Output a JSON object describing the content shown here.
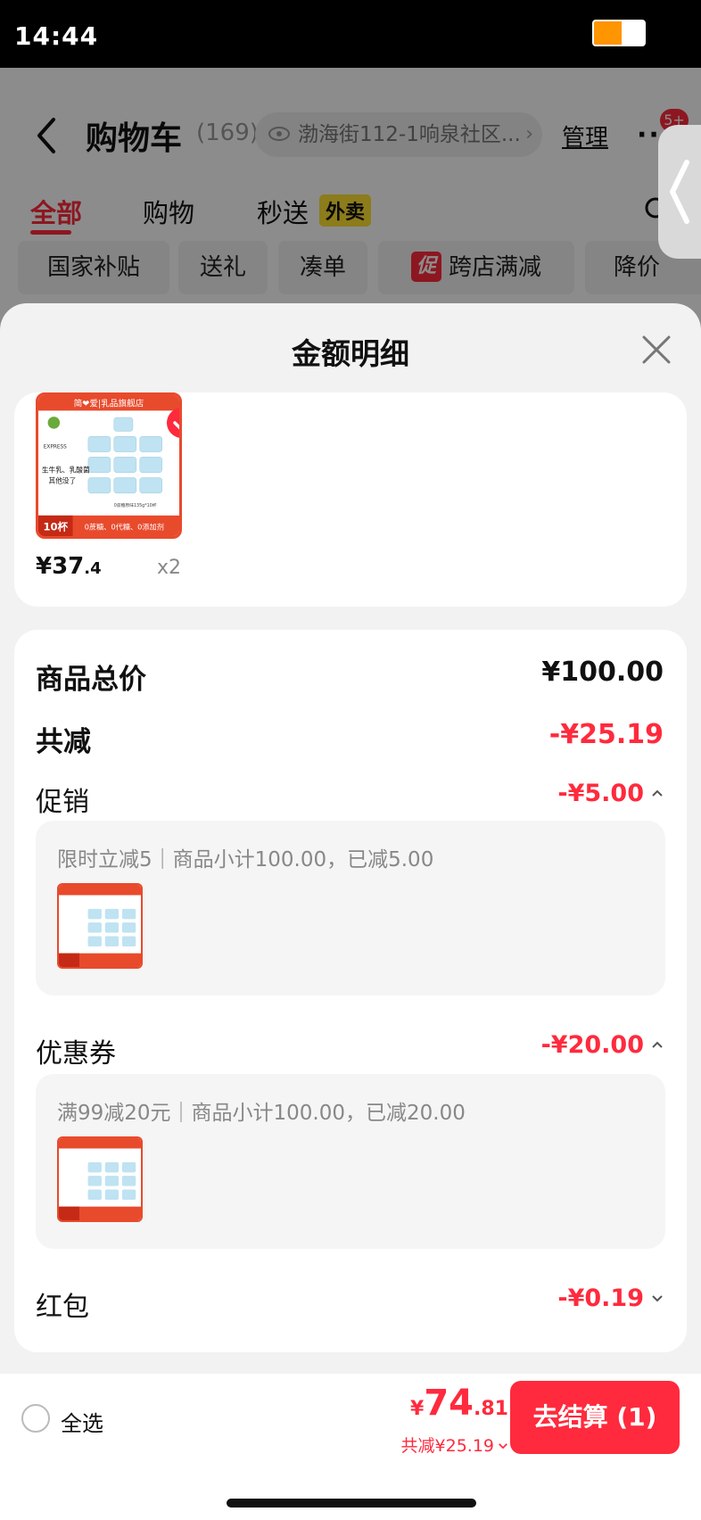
{
  "status_bar": {
    "time": "14:44",
    "battery_level": 0.55
  },
  "header": {
    "title": "购物车",
    "count": "(169)",
    "address": "渤海街112-1响泉社区...",
    "address_chevron": "›",
    "manage": "管理",
    "more": "··",
    "badge": "5+"
  },
  "tabs": [
    {
      "label": "全部"
    },
    {
      "label": "购物"
    },
    {
      "label": "秒送"
    }
  ],
  "waimai_tag": "外卖",
  "filters": [
    {
      "label": "国家补贴"
    },
    {
      "label": "送礼"
    },
    {
      "label": "凑单"
    },
    {
      "label": "跨店满减",
      "tag": "促"
    },
    {
      "label": "降价"
    }
  ],
  "sheet": {
    "title": "金额明细",
    "product": {
      "price_main": "¥37",
      "price_decimal": ".4",
      "quantity": "x2",
      "image_label_store": "简❤爱|乳品旗舰店",
      "image_label_line1": "生牛乳、乳酸菌",
      "image_label_line2": "其他没了",
      "image_label_cups": "10杯",
      "image_label_bottom": "0蔗糖、0代糖、0添加剂",
      "image_label_spec": "0蔗糖原味135g*10杯",
      "image_label_express": "EXPRESS"
    },
    "summary": {
      "total_label": "商品总价",
      "total_value": "¥100.00",
      "reduce_label": "共减",
      "reduce_value": "-¥25.19",
      "promo_label": "促销",
      "promo_value": "-¥5.00",
      "promo_detail": "限时立减5｜商品小计100.00，已减5.00",
      "coupon_label": "优惠券",
      "coupon_value": "-¥20.00",
      "coupon_detail": "满99减20元｜商品小计100.00，已减20.00",
      "redpacket_label": "红包",
      "redpacket_value": "-¥0.19"
    }
  },
  "bottom": {
    "select_all": "全选",
    "yen": "¥",
    "total_int": "74",
    "total_dec": ".81",
    "discount": "共减¥25.19",
    "checkout": "去结算 (1)"
  },
  "colors": {
    "accent": "#ff2a3d",
    "waimai": "#ffe232"
  },
  "icons": [
    "back-icon",
    "eye-icon",
    "search-icon",
    "close-icon",
    "check-icon",
    "chevron-up-icon",
    "chevron-down-icon",
    "side-handle-chevron-icon",
    "battery-icon"
  ]
}
